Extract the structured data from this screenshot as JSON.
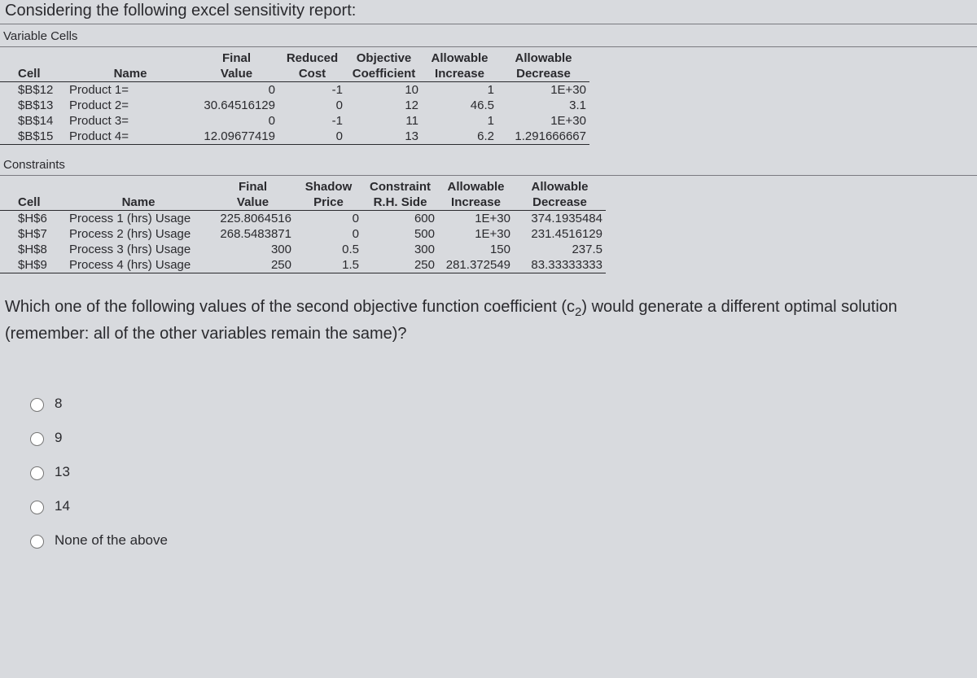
{
  "intro": "Considering the following excel sensitivity report:",
  "section1": "Variable Cells",
  "section2": "Constraints",
  "vc_headers_top": [
    "",
    "",
    "Final",
    "Reduced",
    "Objective",
    "Allowable",
    "Allowable"
  ],
  "vc_headers_bot": [
    "Cell",
    "Name",
    "Value",
    "Cost",
    "Coefficient",
    "Increase",
    "Decrease"
  ],
  "vc_rows": [
    {
      "cell": "$B$12",
      "name": "Product 1=",
      "fv": "0",
      "rc": "-1",
      "oc": "10",
      "ai": "1",
      "ad": "1E+30"
    },
    {
      "cell": "$B$13",
      "name": "Product 2=",
      "fv": "30.64516129",
      "rc": "0",
      "oc": "12",
      "ai": "46.5",
      "ad": "3.1"
    },
    {
      "cell": "$B$14",
      "name": "Product 3=",
      "fv": "0",
      "rc": "-1",
      "oc": "11",
      "ai": "1",
      "ad": "1E+30"
    },
    {
      "cell": "$B$15",
      "name": "Product 4=",
      "fv": "12.09677419",
      "rc": "0",
      "oc": "13",
      "ai": "6.2",
      "ad": "1.291666667"
    }
  ],
  "co_headers_top": [
    "",
    "",
    "Final",
    "Shadow",
    "Constraint",
    "Allowable",
    "Allowable"
  ],
  "co_headers_bot": [
    "Cell",
    "Name",
    "Value",
    "Price",
    "R.H. Side",
    "Increase",
    "Decrease"
  ],
  "co_rows": [
    {
      "cell": "$H$6",
      "name": "Process 1 (hrs) Usage",
      "fv": "225.8064516",
      "rc": "0",
      "oc": "600",
      "ai": "1E+30",
      "ad": "374.1935484"
    },
    {
      "cell": "$H$7",
      "name": "Process 2 (hrs) Usage",
      "fv": "268.5483871",
      "rc": "0",
      "oc": "500",
      "ai": "1E+30",
      "ad": "231.4516129"
    },
    {
      "cell": "$H$8",
      "name": "Process 3 (hrs) Usage",
      "fv": "300",
      "rc": "0.5",
      "oc": "300",
      "ai": "150",
      "ad": "237.5"
    },
    {
      "cell": "$H$9",
      "name": "Process 4 (hrs) Usage",
      "fv": "250",
      "rc": "1.5",
      "oc": "250",
      "ai": "281.372549",
      "ad": "83.33333333"
    }
  ],
  "question_pre": "Which one of the following values of the second objective function coefficient (c",
  "question_sub": "2",
  "question_post": ") would generate a different optimal solution (remember: all of the other variables remain the same)?",
  "options": [
    "8",
    "9",
    "13",
    "14",
    "None of the above"
  ],
  "chart_data": {
    "type": "table",
    "title": "Excel Sensitivity Report",
    "tables": [
      {
        "name": "Variable Cells",
        "columns": [
          "Cell",
          "Name",
          "Final Value",
          "Reduced Cost",
          "Objective Coefficient",
          "Allowable Increase",
          "Allowable Decrease"
        ],
        "rows": [
          [
            "$B$12",
            "Product 1=",
            0,
            -1,
            10,
            1,
            "1E+30"
          ],
          [
            "$B$13",
            "Product 2=",
            30.64516129,
            0,
            12,
            46.5,
            3.1
          ],
          [
            "$B$14",
            "Product 3=",
            0,
            -1,
            11,
            1,
            "1E+30"
          ],
          [
            "$B$15",
            "Product 4=",
            12.09677419,
            0,
            13,
            6.2,
            1.291666667
          ]
        ]
      },
      {
        "name": "Constraints",
        "columns": [
          "Cell",
          "Name",
          "Final Value",
          "Shadow Price",
          "Constraint R.H. Side",
          "Allowable Increase",
          "Allowable Decrease"
        ],
        "rows": [
          [
            "$H$6",
            "Process 1 (hrs) Usage",
            225.8064516,
            0,
            600,
            "1E+30",
            374.1935484
          ],
          [
            "$H$7",
            "Process 2 (hrs) Usage",
            268.5483871,
            0,
            500,
            "1E+30",
            231.4516129
          ],
          [
            "$H$8",
            "Process 3 (hrs) Usage",
            300,
            0.5,
            300,
            150,
            237.5
          ],
          [
            "$H$9",
            "Process 4 (hrs) Usage",
            250,
            1.5,
            250,
            281.372549,
            83.33333333
          ]
        ]
      }
    ]
  }
}
